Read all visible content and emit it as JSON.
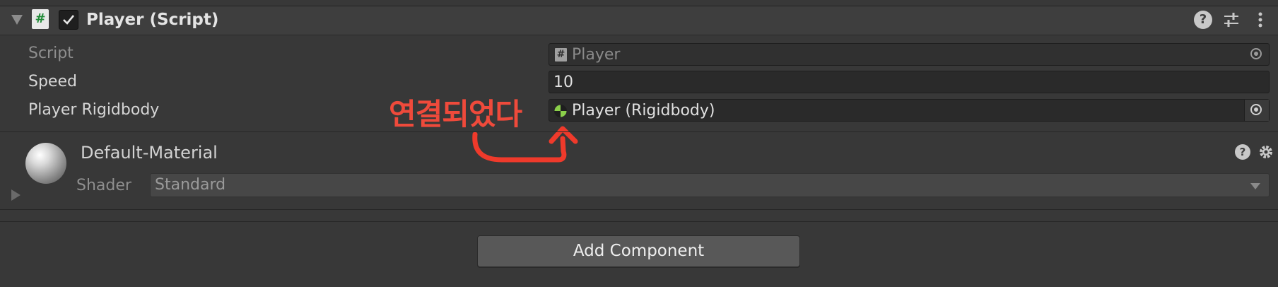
{
  "component": {
    "title": "Player (Script)",
    "enabled": true,
    "icons": [
      "script-hash-icon",
      "help-icon",
      "preset-sliders-icon",
      "more-vert-icon"
    ],
    "help_glyph": "?",
    "hash_glyph": "#"
  },
  "properties": [
    {
      "label": "Script",
      "value": "Player",
      "disabled": true
    },
    {
      "label": "Speed",
      "value": "10"
    },
    {
      "label": "Player Rigidbody",
      "value": "Player (Rigidbody)"
    }
  ],
  "annotation": {
    "text": "연결되었다",
    "color": "#ef4a3b"
  },
  "material": {
    "name": "Default-Material",
    "shader_label": "Shader",
    "shader_value": "Standard",
    "help_glyph": "?"
  },
  "add_component_label": "Add Component",
  "colors": {
    "background": "#383838",
    "header": "#3e3e3e",
    "field": "#2a2a2a",
    "accent_rigidbody": "#8bd04a"
  }
}
